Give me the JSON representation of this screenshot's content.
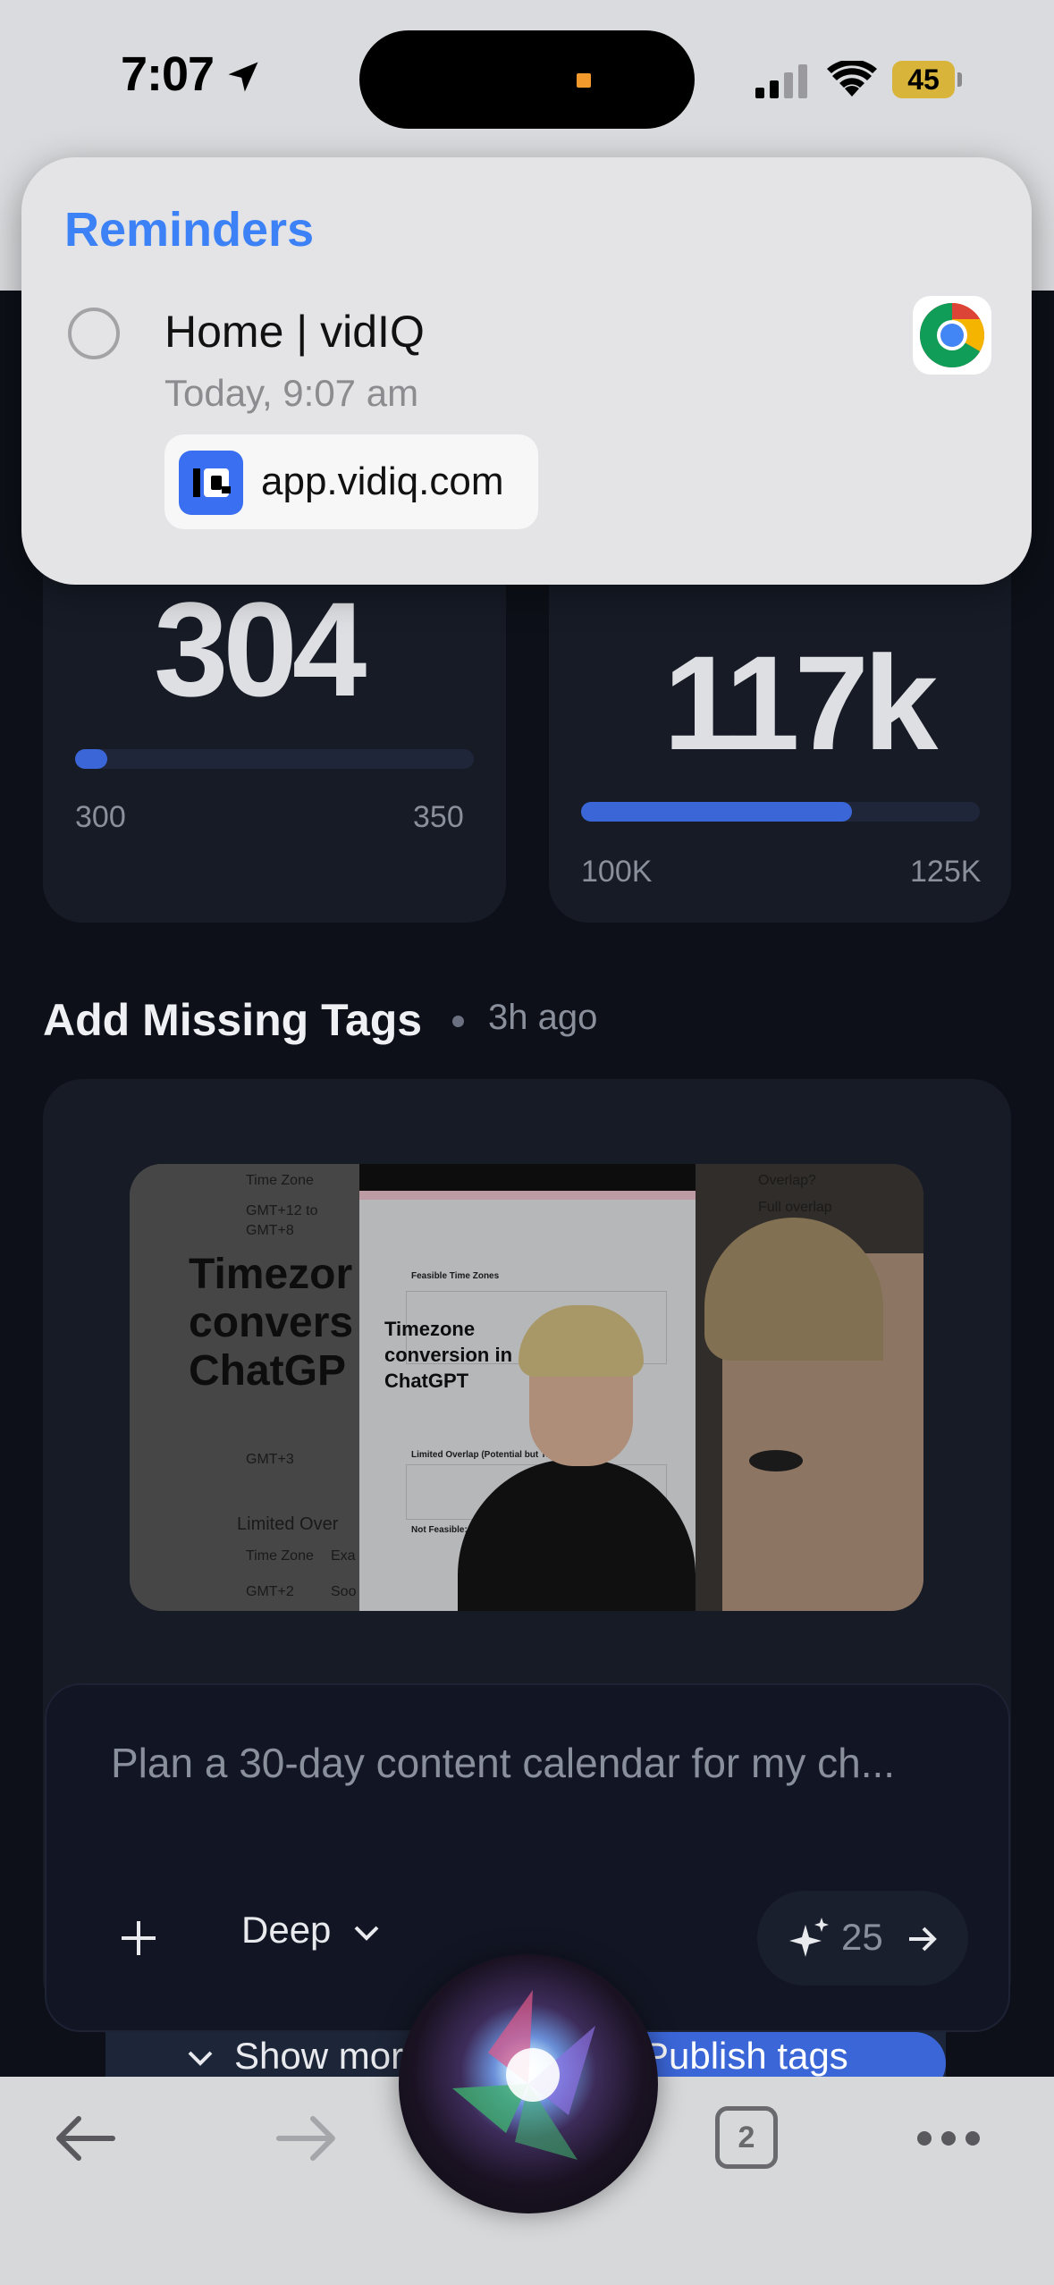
{
  "status_bar": {
    "time": "7:07",
    "battery": "45"
  },
  "notification": {
    "app": "Reminders",
    "title": "Home | vidIQ",
    "time": "Today, 9:07 am",
    "link": "app.vidiq.com"
  },
  "stats": [
    {
      "value": "304",
      "min": "300",
      "max": "350",
      "progress": 0.08
    },
    {
      "value": "117k",
      "min": "100K",
      "max": "125K",
      "progress": 0.68
    }
  ],
  "section": {
    "title": "Add Missing Tags",
    "time": "3h ago"
  },
  "thumbnail": {
    "left_text": [
      "Time Zone",
      "GMT+12 to",
      "GMT+8",
      "Timezor",
      "convers",
      "ChatGP",
      "GMT+3",
      "Limited Over",
      "Time Zone",
      "GMT+2",
      "Exa",
      "Soo"
    ],
    "center_caption": [
      "Timezone",
      "conversion in",
      "ChatGPT"
    ],
    "center_headings": [
      "Feasible Time Zones",
      "Limited Overlap (Potential but Tricky)",
      "Not Feasible:"
    ],
    "right_text": [
      "Overlap?",
      "Full overlap"
    ]
  },
  "chat": {
    "placeholder": "Plan a 30-day content calendar for my ch...",
    "mode": "Deep",
    "credits": "25"
  },
  "actions": {
    "show_more": "Show mor",
    "publish": "Publish tags"
  },
  "toolbar": {
    "tab_count": "2"
  },
  "colors": {
    "accent": "#3b66d8",
    "reminders_blue": "#3c82f6",
    "card_bg": "#161b26",
    "page_bg": "#0d1018"
  }
}
